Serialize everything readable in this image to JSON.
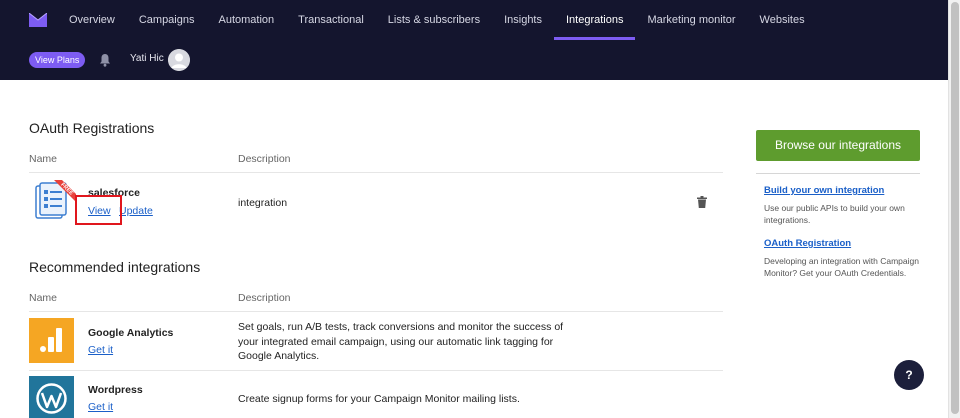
{
  "nav": {
    "items": [
      {
        "label": "Overview"
      },
      {
        "label": "Campaigns"
      },
      {
        "label": "Automation"
      },
      {
        "label": "Transactional"
      },
      {
        "label": "Lists & subscribers"
      },
      {
        "label": "Insights"
      },
      {
        "label": "Integrations",
        "active": true
      },
      {
        "label": "Marketing monitor"
      },
      {
        "label": "Websites"
      }
    ],
    "view_plans": "View Plans",
    "user_name": "Yati Hic",
    "accent": "#7d5cf2",
    "background": "#14152e"
  },
  "oauth": {
    "title": "OAuth Registrations",
    "col_name": "Name",
    "col_desc": "Description",
    "row": {
      "name": "salesforce",
      "view": "View",
      "update": "Update",
      "description": "integration",
      "badge": "FREE"
    }
  },
  "recommended": {
    "title": "Recommended integrations",
    "col_name": "Name",
    "col_desc": "Description",
    "rows": [
      {
        "name": "Google Analytics",
        "link": "Get it",
        "description": "Set goals, run A/B tests, track conversions and monitor the success of your integrated email campaign, using our automatic link tagging for Google Analytics."
      },
      {
        "name": "Wordpress",
        "link": "Get it",
        "description": "Create signup forms for your Campaign Monitor mailing lists."
      }
    ]
  },
  "sidebar": {
    "browse": "Browse our integrations",
    "build_link": "Build your own integration",
    "build_text": "Use our public APIs to build your own integrations.",
    "oauth_link": "OAuth Registration",
    "oauth_text": "Developing an integration with Campaign Monitor? Get your OAuth Credentials.",
    "button_color": "#5e9c2e",
    "link_color": "#1a5fc8"
  },
  "help": {
    "label": "?"
  }
}
